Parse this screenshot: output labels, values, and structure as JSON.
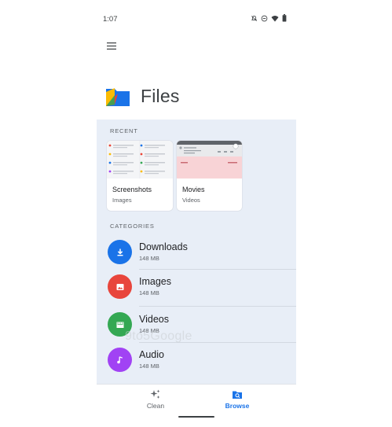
{
  "status_bar": {
    "time": "1:07",
    "icons": [
      "mute-icon",
      "dnd-icon",
      "wifi-icon",
      "battery-icon"
    ]
  },
  "app": {
    "menu_icon": "hamburger-menu-icon",
    "title": "Files"
  },
  "recent": {
    "label": "RECENT",
    "cards": [
      {
        "title": "Screenshots",
        "subtitle": "Images"
      },
      {
        "title": "Movies",
        "subtitle": "Videos"
      }
    ]
  },
  "categories": {
    "label": "CATEGORIES",
    "items": [
      {
        "name": "Downloads",
        "size": "148 MB",
        "icon": "download-icon",
        "color": "#1a73e8"
      },
      {
        "name": "Images",
        "size": "148 MB",
        "icon": "image-icon",
        "color": "#e8453c"
      },
      {
        "name": "Videos",
        "size": "148 MB",
        "icon": "video-icon",
        "color": "#34a853"
      },
      {
        "name": "Audio",
        "size": "148 MB",
        "icon": "audio-icon",
        "color": "#a142f4"
      }
    ]
  },
  "watermark": "9to5Google",
  "bottom_nav": {
    "items": [
      {
        "label": "Clean",
        "icon": "sparkle-icon",
        "active": false
      },
      {
        "label": "Browse",
        "icon": "browse-icon",
        "active": true
      }
    ]
  },
  "colors": {
    "accent": "#1a73e8",
    "content_background": "#e8eef7"
  }
}
